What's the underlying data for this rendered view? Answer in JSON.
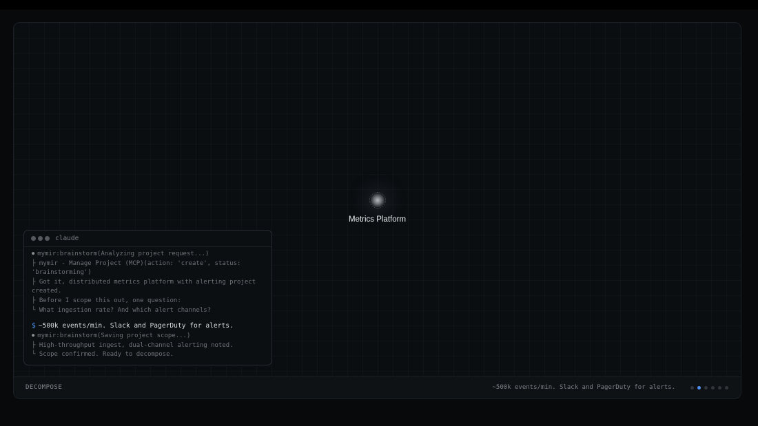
{
  "canvas": {
    "node": {
      "label": "Metrics Platform"
    }
  },
  "terminal": {
    "title": "claude",
    "lines": [
      {
        "kind": "bullet",
        "text": "mymir:brainstorm(Analyzing project request...)"
      },
      {
        "kind": "branch",
        "text": "├ mymir - Manage Project (MCP)(action: 'create', status: 'brainstorming')"
      },
      {
        "kind": "branch",
        "text": "├ Got it, distributed metrics platform with alerting project created."
      },
      {
        "kind": "branch",
        "text": "├ Before I scope this out, one question:"
      },
      {
        "kind": "branch",
        "text": "└ What ingestion rate? And which alert channels?"
      },
      {
        "kind": "prompt",
        "sign": "$",
        "text": "~500k events/min. Slack and PagerDuty for alerts."
      },
      {
        "kind": "bullet",
        "text": "mymir:brainstorm(Saving project scope...)"
      },
      {
        "kind": "branch",
        "text": "├ High-throughput ingest, dual-channel alerting noted."
      },
      {
        "kind": "branch",
        "text": "└ Scope confirmed. Ready to decompose."
      }
    ]
  },
  "footer": {
    "label": "DECOMPOSE",
    "status": "~500k events/min. Slack and PagerDuty for alerts.",
    "pager": {
      "count": 6,
      "active_index": 1
    }
  },
  "colors": {
    "accent": "#4f8ff0",
    "background": "#07090b"
  }
}
